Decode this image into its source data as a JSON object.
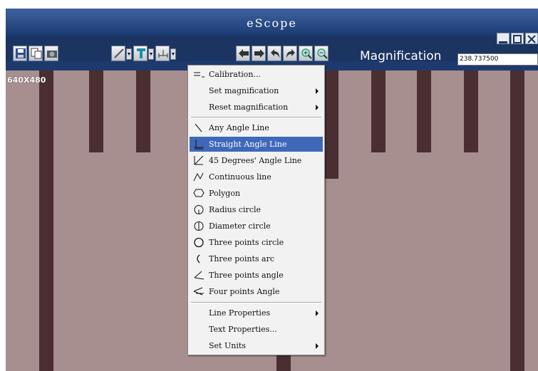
{
  "window": {
    "title": "eScope"
  },
  "magnification": {
    "label": "Magnification",
    "value": "238.737500"
  },
  "viewport": {
    "resolution": "640X480"
  },
  "menu": {
    "calibration": "Calibration...",
    "set_magnification": "Set magnification",
    "reset_magnification": "Reset magnification",
    "tools": [
      {
        "label": "Any Angle Line",
        "icon": "any-angle-line-icon"
      },
      {
        "label": "Straight Angle Line",
        "icon": "straight-angle-line-icon",
        "selected": true
      },
      {
        "label": "45 Degrees' Angle Line",
        "icon": "45-degrees-angle-line-icon"
      },
      {
        "label": "Continuous line",
        "icon": "continuous-line-icon"
      },
      {
        "label": "Polygon",
        "icon": "polygon-icon"
      },
      {
        "label": "Radius circle",
        "icon": "radius-circle-icon"
      },
      {
        "label": "Diameter circle",
        "icon": "diameter-circle-icon"
      },
      {
        "label": "Three points circle",
        "icon": "three-points-circle-icon"
      },
      {
        "label": "Three points arc",
        "icon": "three-points-arc-icon"
      },
      {
        "label": "Three points angle",
        "icon": "three-points-angle-icon"
      },
      {
        "label": "Four points Angle",
        "icon": "four-points-angle-icon"
      }
    ],
    "line_properties": "Line Properties",
    "text_properties": "Text Properties...",
    "set_units": "Set Units"
  },
  "colors": {
    "title_bar": "#1b3a72",
    "menu_selection": "#3f69b8",
    "specimen": "#a78e8f",
    "scale_ticks": "#4a2e31"
  }
}
